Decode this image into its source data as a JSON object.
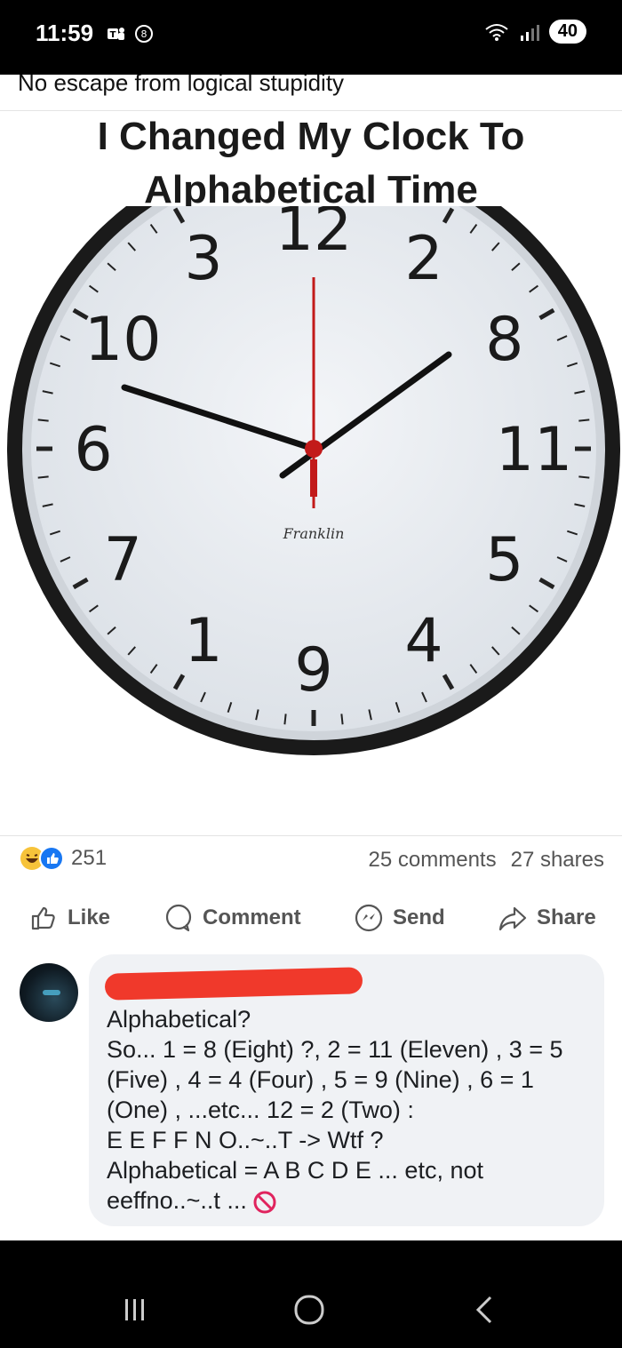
{
  "status_bar": {
    "time": "11:59",
    "battery": "40",
    "icons_left": [
      "teams-icon",
      "alarm-icon"
    ],
    "icons_right": [
      "wifi-icon",
      "signal-icon"
    ]
  },
  "post": {
    "caption": "No escape from logical stupidity",
    "meme_title_line1": "I Changed My Clock To",
    "meme_title_line2": "Alphabetical Time",
    "clock": {
      "numbers": [
        "12",
        "2",
        "8",
        "11",
        "5",
        "4",
        "9",
        "1",
        "7",
        "6",
        "10",
        "3"
      ],
      "brand": "Franklin"
    },
    "reaction_count": "251",
    "comments_count": "25 comments",
    "shares_count": "27 shares",
    "actions": {
      "like": "Like",
      "comment": "Comment",
      "send": "Send",
      "share": "Share"
    }
  },
  "comment": {
    "text": "Alphabetical?\nSo... 1 = 8 (Eight) ?, 2 = 11 (Eleven) , 3 = 5 (Five) , 4 = 4 (Four) , 5 = 9 (Nine) , 6 = 1 (One) , ...etc... 12 = 2 (Two) :\nE E F F N O..~..T -> Wtf ?\nAlphabetical = A B C D E ... etc, not eeffno..~..t ...",
    "end_icon": "no-entry-icon"
  },
  "colors": {
    "red_redaction": "#f0392b",
    "fb_blue": "#1877f2",
    "bubble_bg": "#f0f2f5"
  }
}
